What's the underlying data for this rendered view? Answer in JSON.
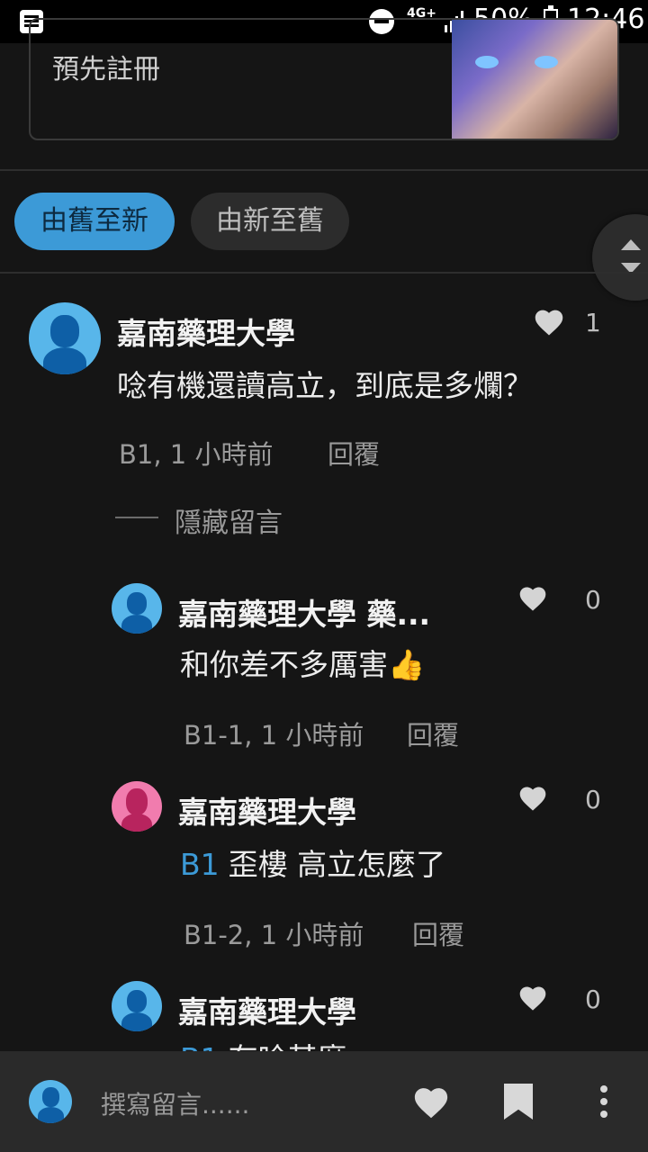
{
  "status_bar": {
    "network": "4G+",
    "battery": "50%",
    "time": "12:46",
    "battery_level": 0.5
  },
  "top_card": {
    "label": "預先註冊"
  },
  "sort": {
    "old_to_new": "由舊至新",
    "new_to_old": "由新至舊"
  },
  "comments": [
    {
      "author": "嘉南藥理大學",
      "text": "唸有機還讀高立，到底是多爛？",
      "floor": "B1",
      "time": "1 小時前",
      "likes": "1",
      "reply": "回覆",
      "hide": "隱藏留言"
    },
    {
      "author": "嘉南藥理大學 藥...",
      "text": "和你差不多厲害👍",
      "floor": "B1-1",
      "time": "1 小時前",
      "likes": "0",
      "reply": "回覆"
    },
    {
      "author": "嘉南藥理大學",
      "tag": "B1",
      "text": "歪樓 高立怎麼了",
      "floor": "B1-2",
      "time": "1 小時前",
      "likes": "0",
      "reply": "回覆"
    },
    {
      "author": "嘉南藥理大學",
      "tag": "B1",
      "text": "有唸甚麼",
      "likes": "0"
    }
  ],
  "bottom_bar": {
    "placeholder": "撰寫留言......"
  },
  "colors": {
    "background": "#151515",
    "accent": "#3c9ad7",
    "avatar_blue": "#58b6ea",
    "avatar_pink": "#f17cae"
  }
}
